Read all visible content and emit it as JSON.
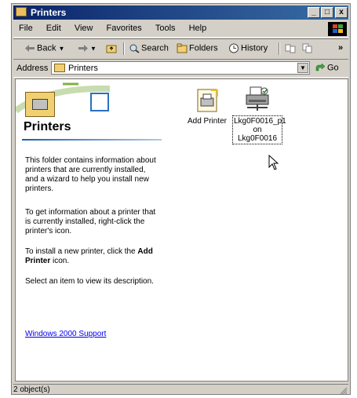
{
  "window": {
    "title": "Printers",
    "controls": {
      "minimize": "_",
      "maximize": "□",
      "close": "x"
    }
  },
  "menu": {
    "items": [
      "File",
      "Edit",
      "View",
      "Favorites",
      "Tools",
      "Help"
    ]
  },
  "toolbar": {
    "back_label": "Back",
    "search_label": "Search",
    "folders_label": "Folders",
    "history_label": "History",
    "chevron": "»"
  },
  "address": {
    "label": "Address",
    "value": "Printers",
    "go_label": "Go"
  },
  "left_pane": {
    "title": "Printers",
    "paragraphs": [
      "This folder contains information about printers that are currently installed, and a wizard to help you install new printers.",
      "To get information about a printer that is currently installed, right-click the printer's icon.",
      "Select an item to view its description."
    ],
    "install_prefix": "To install a new printer, click the",
    "install_bold": "Add Printer",
    "install_suffix": "icon.",
    "support_link": "Windows 2000 Support"
  },
  "items": [
    {
      "label": "Add Printer",
      "icon": "add-printer-icon"
    },
    {
      "label_line1": "Lkg0F0016_p1",
      "label_line2": "on Lkg0F0016",
      "icon": "network-printer-icon"
    }
  ],
  "status": {
    "text": "2 object(s)"
  },
  "colors": {
    "title_bar_start": "#0a246a",
    "title_bar_end": "#3a6ea5",
    "chrome": "#d4d0c8",
    "link": "#0000ee"
  }
}
